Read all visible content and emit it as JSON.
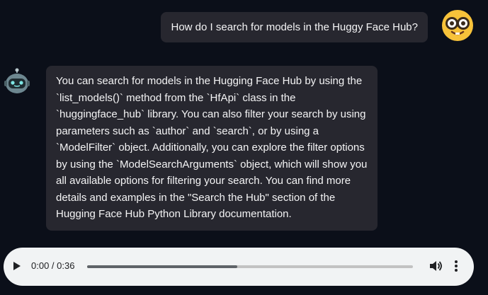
{
  "chat": {
    "user_message": "How do I search for models in the Huggy Face Hub?",
    "bot_message": "You can search for models in the Hugging Face Hub by using the `list_models()` method from the `HfApi` class in the `huggingface_hub` library. You can also filter your search by using parameters such as `author` and `search`, or by using a `ModelFilter` object. Additionally, you can explore the filter options by using the `ModelSearchArguments` object, which will show you all available options for filtering your search. You can find more details and examples in the \"Search the Hub\" section of the Hugging Face Hub Python Library documentation."
  },
  "audio_player": {
    "time_display": "0:00 / 0:36",
    "buffered_fraction": 0.46
  },
  "icons": {
    "user_avatar": "nerd-face-emoji-icon",
    "bot_avatar": "robot-icon",
    "play": "play-icon",
    "volume": "volume-icon",
    "more": "more-vertical-icon"
  },
  "colors": {
    "background": "#0b0f19",
    "bubble": "#27272f",
    "player_background": "#f1f3f4"
  }
}
